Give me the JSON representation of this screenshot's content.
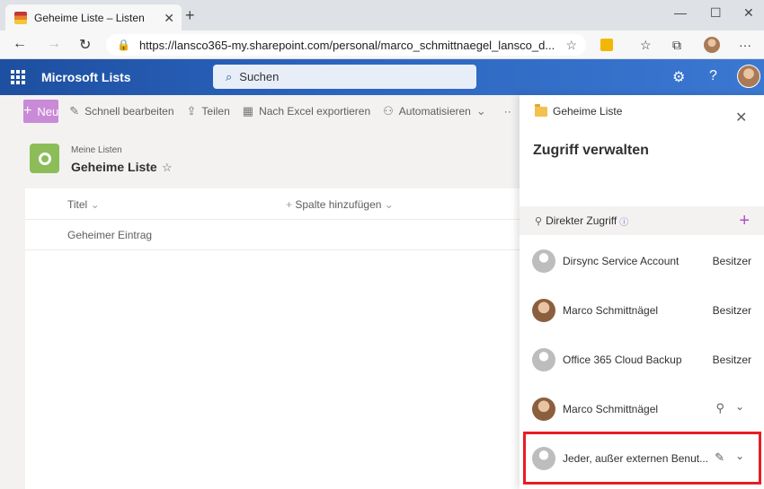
{
  "browser": {
    "tab_title": "Geheime Liste – Listen",
    "tab_close": "✕",
    "new_tab": "+",
    "url": "https://lansco365-my.sharepoint.com/personal/marco_schmittnaegel_lansco_d...",
    "window_controls": {
      "minimize": "—",
      "maximize": "☐",
      "close": "✕"
    }
  },
  "suite": {
    "app_name": "Microsoft Lists",
    "search_placeholder": "Suchen",
    "help_label": "?"
  },
  "commands": {
    "new_label": "Neu",
    "quick_edit": "Schnell bearbeiten",
    "share": "Teilen",
    "export_excel": "Nach Excel exportieren",
    "automate": "Automatisieren",
    "more": "··"
  },
  "list": {
    "breadcrumb": "Meine Listen",
    "title": "Geheime Liste",
    "columns": {
      "title": "Titel",
      "add_column": "Spalte hinzufügen"
    },
    "rows": [
      {
        "title": "Geheimer Eintrag"
      }
    ]
  },
  "panel": {
    "context_folder": "Geheime Liste",
    "heading": "Zugriff verwalten",
    "section_label": "Direkter Zugriff",
    "people": [
      {
        "name": "Dirsync Service Account",
        "role": "Besitzer",
        "avatar": "generic"
      },
      {
        "name": "Marco Schmittnägel",
        "role": "Besitzer",
        "avatar": "photo"
      },
      {
        "name": "Office 365 Cloud Backup",
        "role": "Besitzer",
        "avatar": "generic"
      },
      {
        "name": "Marco Schmittnägel",
        "role": "",
        "avatar": "photo",
        "icon": "person-edit-icon"
      },
      {
        "name": "Jeder, außer externen Benut...",
        "role": "",
        "avatar": "generic",
        "icon": "edit-off-icon"
      }
    ]
  },
  "colors": {
    "suite_bar": "#2a63bd",
    "new_button": "#c98ad7",
    "accent_purple": "#b04ec6",
    "highlight_red": "#e81c24"
  }
}
